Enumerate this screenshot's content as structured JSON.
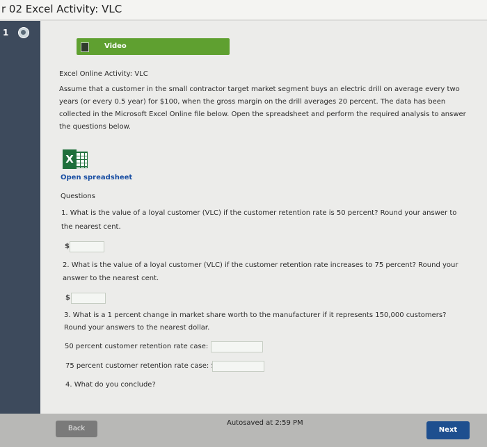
{
  "window": {
    "title": "r 02 Excel Activity: VLC"
  },
  "sidebar": {
    "question_number": "1",
    "status_icon": "check-circle-icon"
  },
  "video": {
    "label": "Video",
    "icon": "film-icon"
  },
  "activity": {
    "title": "Excel Online Activity: VLC",
    "intro_lines": [
      "Assume that a customer in the small contractor target market segment buys an electric drill on average every two",
      "years (or every 0.5 year) for $100, when the gross margin on the drill averages 20 percent. The data has been",
      "collected in the Microsoft Excel Online file below. Open the spreadsheet and perform the required analysis to answer",
      "the questions below."
    ],
    "excel_icon_letter": "X",
    "open_link": "Open spreadsheet",
    "questions_heading": "Questions"
  },
  "questions": {
    "q1_lines": [
      "1. What is the value of a loyal customer (VLC) if the customer retention rate is 50 percent? Round your answer to",
      "the nearest cent."
    ],
    "q2_lines": [
      "2. What is the value of a loyal customer (VLC) if the customer retention rate increases to 75 percent? Round your",
      "answer to the nearest cent."
    ],
    "q3_lines": [
      "3. What is a 1 percent change in market share worth to the manufacturer if it represents 150,000 customers?",
      "Round your answers to the nearest dollar."
    ],
    "q3_case50_label": "50 percent customer retention rate case: $",
    "q3_case75_label": "75 percent customer retention rate case: $",
    "q4_label": "4. What do you conclude?",
    "currency": "$"
  },
  "footer": {
    "back_label": "Back",
    "autosave": "Autosaved at 2:59 PM",
    "next_label": "Next"
  }
}
